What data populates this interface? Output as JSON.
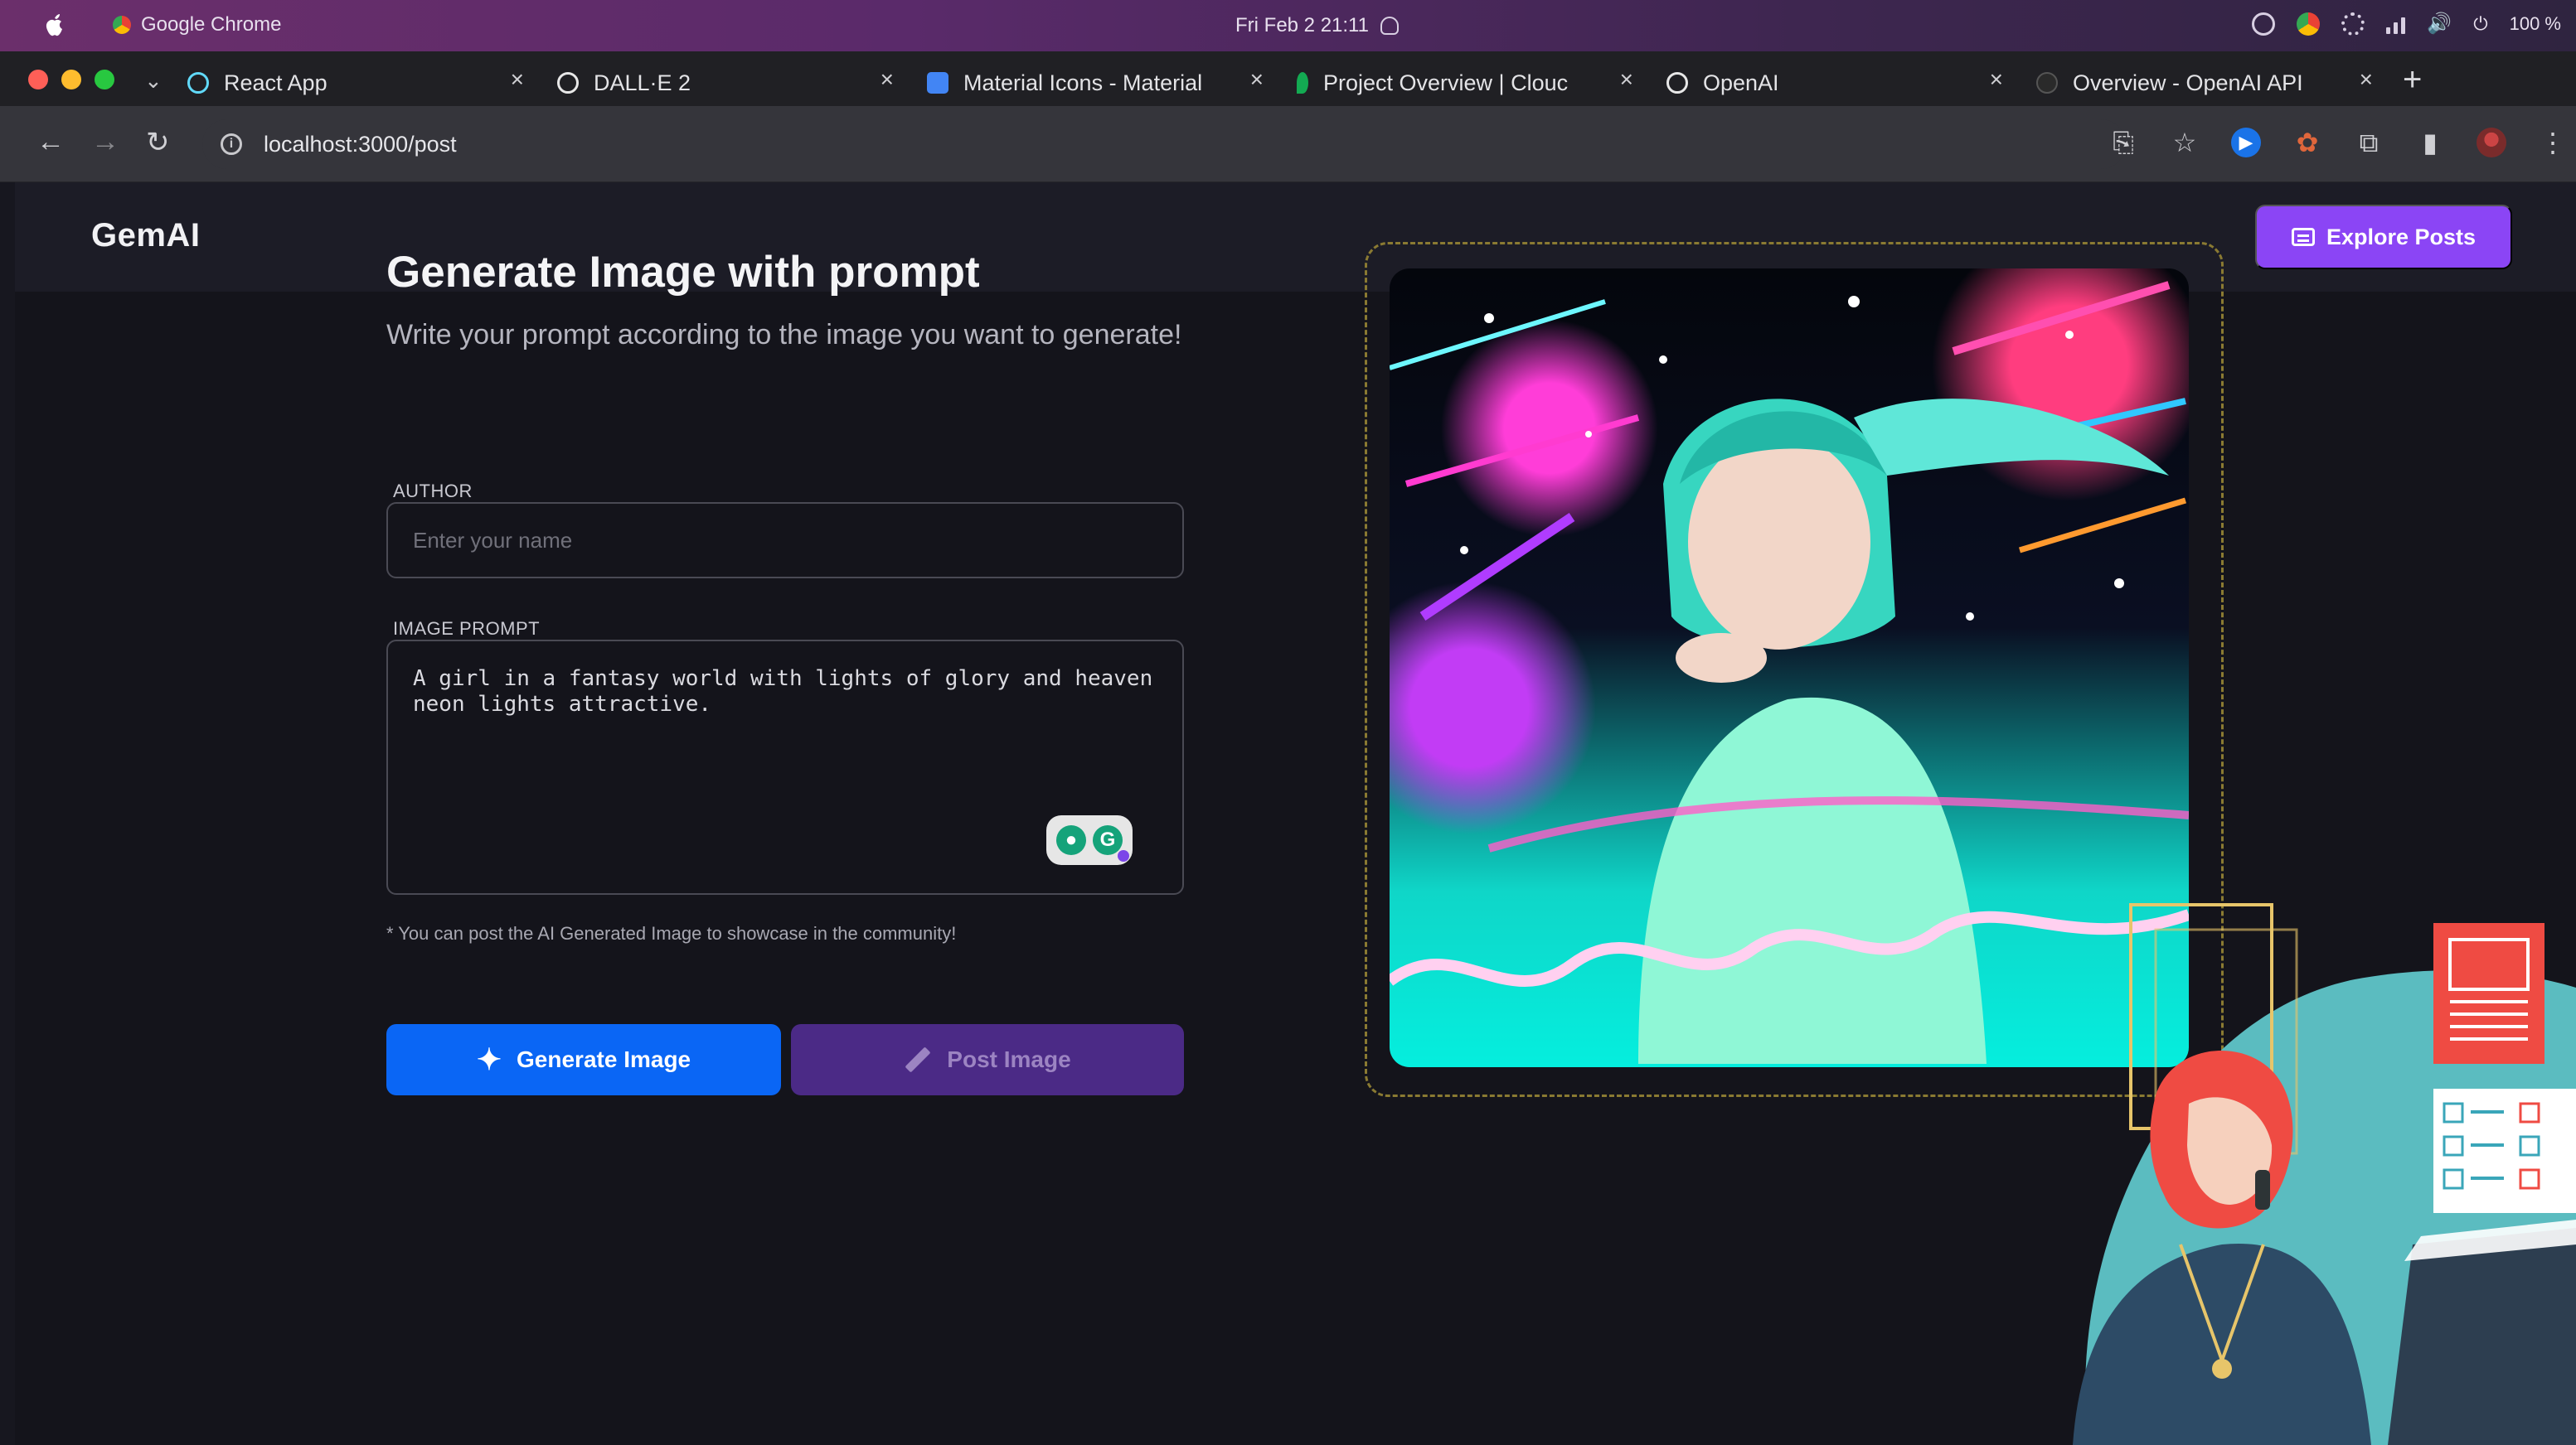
{
  "menubar": {
    "app_name": "Google Chrome",
    "datetime": "Fri Feb 2  21:11",
    "battery": "100 %"
  },
  "tabs": [
    {
      "title": "React App",
      "color": "#61dafb"
    },
    {
      "title": "DALL·E 2",
      "color": "#e8e8e8"
    },
    {
      "title": "Material Icons - Material",
      "color": "#4285f4"
    },
    {
      "title": "Project Overview | Clouc",
      "color": "#13aa52"
    },
    {
      "title": "OpenAI",
      "color": "#e8e8e8"
    },
    {
      "title": "Overview - OpenAI API",
      "color": "#2a2a2a"
    }
  ],
  "toolbar": {
    "url": "localhost:3000/post"
  },
  "app": {
    "logo": "GemAI",
    "explore_label": "Explore Posts",
    "accent": "#8b45f5"
  },
  "form": {
    "title": "Generate Image with prompt",
    "subtitle": "Write your prompt according to the image you want to generate!",
    "author_label": "AUTHOR",
    "author_placeholder": "Enter your name",
    "author_value": "",
    "prompt_label": "IMAGE PROMPT",
    "prompt_value": "A girl in a fantasy world with lights of glory and heaven neon lights attractive.",
    "note": "* You can post the AI Generated Image to showcase in the community!",
    "generate_label": "Generate Image",
    "post_label": "Post Image"
  }
}
